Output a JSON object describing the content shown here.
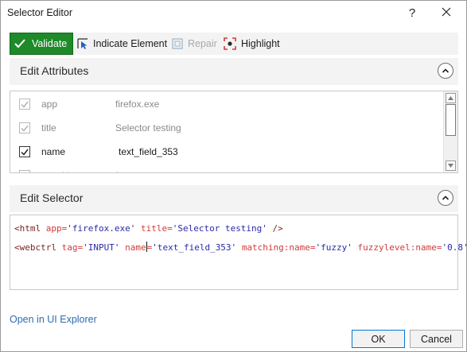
{
  "window": {
    "title": "Selector Editor",
    "help_label": "?"
  },
  "toolbar": {
    "validate_label": "Validate",
    "indicate_label": "Indicate Element",
    "repair_label": "Repair",
    "highlight_label": "Highlight"
  },
  "attributes": {
    "header": "Edit Attributes",
    "rows": [
      {
        "name": "app",
        "value": "firefox.exe",
        "checked": true,
        "enabled": false
      },
      {
        "name": "title",
        "value": "Selector testing",
        "checked": true,
        "enabled": false
      },
      {
        "name": "name",
        "value": "text_field_353",
        "checked": true,
        "enabled": true
      },
      {
        "name": "matching",
        "value": "fuzzy",
        "checked": true,
        "enabled": false
      }
    ]
  },
  "selector": {
    "header": "Edit Selector",
    "line1": {
      "open": "<html ",
      "attr1": "app=",
      "val1": "'firefox.exe'",
      "attr2": "title=",
      "val2": "'Selector testing'",
      "close": " />"
    },
    "line2": {
      "open": "<webctrl ",
      "attr1": "tag=",
      "val1": "'INPUT'",
      "attr2a": "name",
      "attr2b": "=",
      "val2": "'text_field_353'",
      "attr3": "matching:name=",
      "val3": "'fuzzy'",
      "attr4": "fuzzylevel:name=",
      "val4": "'0.8'",
      "close": " />"
    }
  },
  "footer": {
    "link_label": "Open in UI Explorer",
    "ok_label": "OK",
    "cancel_label": "Cancel"
  },
  "colors": {
    "validate_bg": "#1e8a2a",
    "link": "#2d6bb3",
    "accent_red": "#d23a3a",
    "value_blue": "#2a2aa8"
  },
  "icons": [
    "check-icon",
    "indicate-icon",
    "repair-icon",
    "highlight-icon",
    "collapse-icon",
    "close-icon",
    "scroll-up-icon",
    "scroll-down-icon"
  ]
}
